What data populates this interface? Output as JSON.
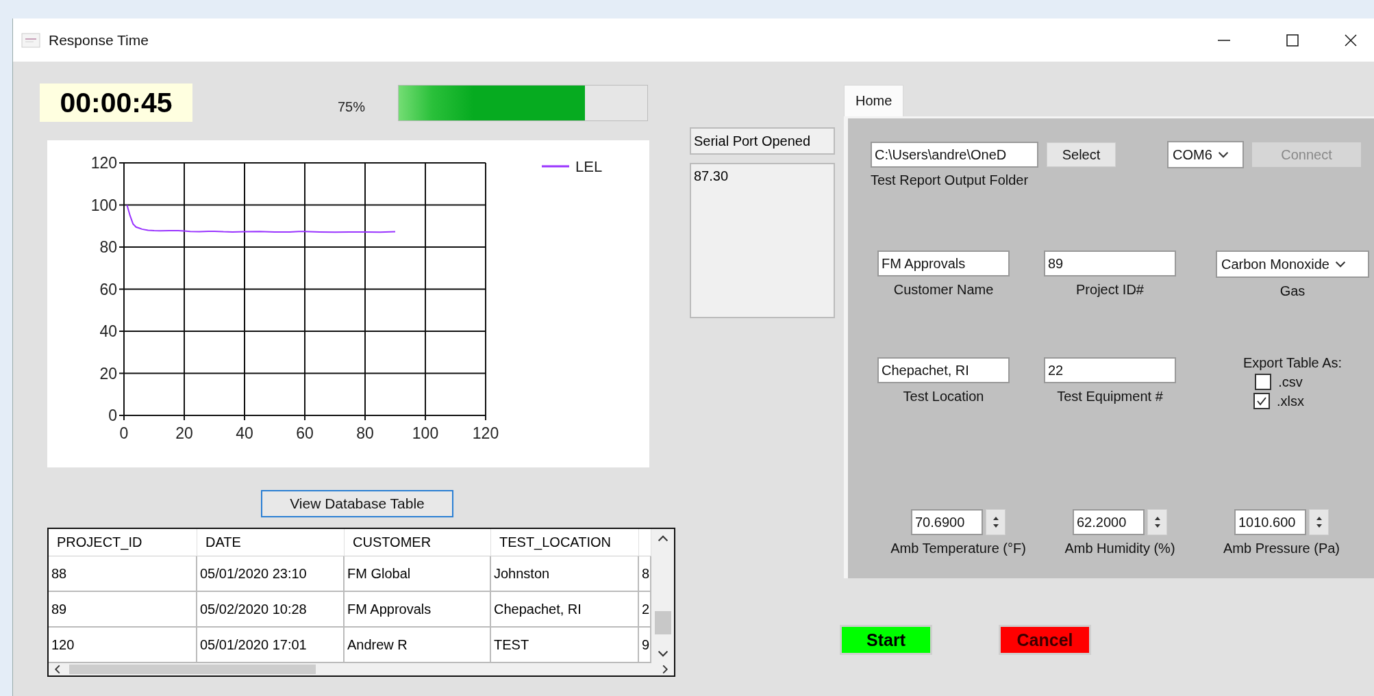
{
  "window": {
    "title": "Response Time"
  },
  "timer": "00:00:45",
  "progress": {
    "reading": "75%",
    "level": 0.75
  },
  "chart": {
    "chart_data": {
      "type": "line",
      "x": [
        1,
        2,
        3,
        4,
        5,
        6,
        8,
        10,
        12,
        15,
        18,
        20,
        22,
        25,
        28,
        30,
        33,
        36,
        40,
        45,
        50,
        55,
        58,
        60,
        65,
        70,
        75,
        80,
        85,
        90
      ],
      "series": [
        {
          "name": "LEL",
          "color": "#9933ff",
          "values": [
            100,
            95,
            91,
            89.5,
            89,
            88.5,
            88,
            87.8,
            87.7,
            87.8,
            87.8,
            87.6,
            87.4,
            87.3,
            87.5,
            87.5,
            87.3,
            87.2,
            87.3,
            87.4,
            87.2,
            87.2,
            87.4,
            87.4,
            87.2,
            87.1,
            87.2,
            87.2,
            87.1,
            87.3
          ]
        }
      ],
      "grid": true,
      "xlim": [
        0,
        120
      ],
      "ylim": [
        0,
        120
      ],
      "xticks": [
        0,
        20,
        40,
        60,
        80,
        100,
        120
      ],
      "yticks": [
        0,
        20,
        40,
        60,
        80,
        100,
        120
      ]
    }
  },
  "view_table_button": "View Database Table",
  "table": {
    "columns": [
      "PROJECT_ID",
      "DATE",
      "CUSTOMER",
      "TEST_LOCATION"
    ],
    "rows": [
      [
        "88",
        "05/01/2020 23:10",
        "FM Global",
        "Johnston",
        "8"
      ],
      [
        "89",
        "05/02/2020 10:28",
        "FM Approvals",
        "Chepachet, RI",
        "2"
      ],
      [
        "120",
        "05/01/2020 17:01",
        "Andrew R",
        "TEST",
        "9"
      ]
    ]
  },
  "serial": {
    "status": "Serial Port Opened",
    "output": "87.30"
  },
  "tabs": [
    {
      "label": "Home",
      "selected": true
    }
  ],
  "folder": {
    "value": "C:\\Users\\andre\\OneD",
    "button": "Select",
    "label": "Test Report Output Folder"
  },
  "port": {
    "value": "COM6",
    "connect": {
      "label": "Connect",
      "disabled": true
    }
  },
  "fields": [
    {
      "kind": "text",
      "value": "FM Approvals",
      "label": "Customer Name"
    },
    {
      "kind": "text",
      "value": "89",
      "label": "Project ID#"
    },
    {
      "kind": "dropdown",
      "value": "Carbon Monoxide",
      "label": "Gas"
    },
    {
      "kind": "text",
      "value": "Chepachet, RI",
      "label": "Test Location"
    },
    {
      "kind": "text",
      "value": "22",
      "label": "Test Equipment #"
    }
  ],
  "export": {
    "label": "Export Table As:",
    "options": [
      {
        "label": ".csv",
        "checked": false
      },
      {
        "label": ".xlsx",
        "checked": true
      }
    ]
  },
  "ambient": [
    {
      "value": "70.6900",
      "label": "Amb Temperature (°F)"
    },
    {
      "value": "62.2000",
      "label": "Amb Humidity (%)"
    },
    {
      "value": "1010.600",
      "label": "Amb Pressure (Pa)"
    }
  ],
  "actions": [
    {
      "kind": "start",
      "label": "Start"
    },
    {
      "kind": "cancel",
      "label": "Cancel"
    }
  ]
}
